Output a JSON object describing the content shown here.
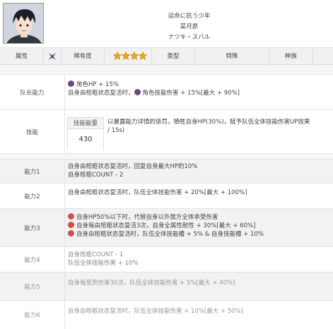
{
  "header": {
    "line1": "运命に抗う少年",
    "line2": "菜月昴",
    "line3": "ナツキ・スバル"
  },
  "attributes": {
    "attr_label": "属性",
    "rarity_label": "稀有度",
    "rarity_stars": 4,
    "type_label": "类型",
    "special_label": "特殊",
    "race_label": "种族",
    "element_icon": "purple-x-element-icon",
    "star_color": "#e8a91c"
  },
  "leader": {
    "label": "队长能力",
    "line1": "角色HP + 15%",
    "line2_prefix": "自身由棺柩状态复活时，",
    "line2_suffix": "角色技能伤害 + 15%[最大 + 90%]"
  },
  "skill": {
    "label": "技能",
    "energy_label": "技能能量",
    "energy_value": "430",
    "desc_line1": "以暴露能力详情的惩罚，牺牲自身HP(30%)，赋予队伍全体技能伤害UP效果",
    "desc_line2": "/ 15s)"
  },
  "abilities": [
    {
      "label": "能力1",
      "lines": [
        "自身由棺柩状态复活时，回复自身最大HP的10%",
        "自身棺柩COUNT - 2"
      ]
    },
    {
      "label": "能力2",
      "lines": [
        "自身由棺柩状态复活时，队伍全体技能伤害 + 20%[最大 + 100%]"
      ]
    },
    {
      "label": "能力3",
      "lines": [
        "自身HP50%以下时，代替自身以外我方全体承受伤害",
        "自身每由棺柩状态复活3次，自身全属性耐性 + 30%[最大 + 60%]",
        "自身由棺柩状态复活时，队伍全体技能槽 + 5% & 自身技能槽 + 10%"
      ]
    },
    {
      "label": "能力4",
      "lines": [
        "自身棺柩COUNT - 1",
        "队伍全体技能伤害 + 10%"
      ]
    },
    {
      "label": "能力5",
      "lines": [
        "自身每受到伤害30次，队伍全体技能伤害 + 5%[最大 + 40%]"
      ]
    },
    {
      "label": "能力6",
      "lines": [
        "自身由棺柩状态复活时，队伍全体技能伤害 + 10%[最大 + 50%]"
      ]
    }
  ],
  "colors": {
    "purple_bullet": "#6b4a77",
    "red_bullet": "#d24e4e"
  }
}
